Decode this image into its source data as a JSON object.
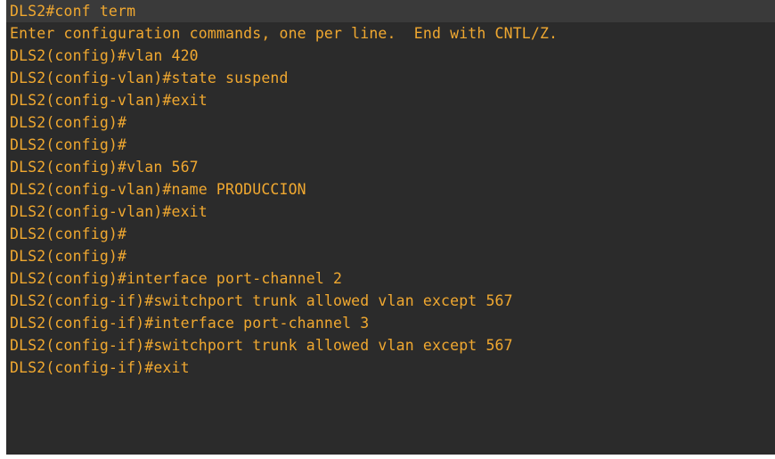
{
  "terminal": {
    "lines": [
      "DLS2#conf term",
      "Enter configuration commands, one per line.  End with CNTL/Z.",
      "DLS2(config)#vlan 420",
      "DLS2(config-vlan)#state suspend",
      "DLS2(config-vlan)#exit",
      "DLS2(config)#",
      "DLS2(config)#",
      "DLS2(config)#vlan 567",
      "DLS2(config-vlan)#name PRODUCCION",
      "DLS2(config-vlan)#exit",
      "DLS2(config)#",
      "DLS2(config)#",
      "DLS2(config)#interface port-channel 2",
      "DLS2(config-if)#switchport trunk allowed vlan except 567",
      "DLS2(config-if)#interface port-channel 3",
      "DLS2(config-if)#switchport trunk allowed vlan except 567",
      "DLS2(config-if)#exit"
    ],
    "text_color": "#f0a830",
    "background_color": "#2b2b2b"
  }
}
